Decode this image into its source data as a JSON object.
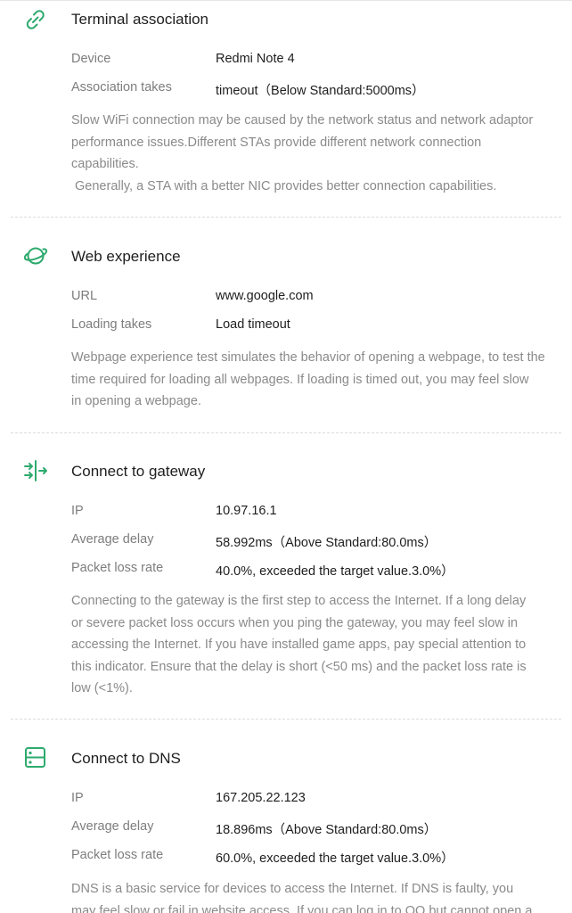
{
  "colors": {
    "accent": "#2eaa6e",
    "label": "#7d7d7d",
    "text": "#1e1e1e",
    "desc": "#8a8a8a"
  },
  "sections": [
    {
      "icon": "link-icon",
      "title": "Terminal association",
      "rows": [
        {
          "label": "Device",
          "value": "Redmi Note 4"
        },
        {
          "label": "Association takes",
          "value": "timeout（Below Standard:5000ms）"
        }
      ],
      "description": [
        "Slow WiFi connection may be caused by the network status and network adaptor",
        "performance issues.Different STAs provide different network connection",
        "capabilities.",
        " Generally, a STA with a better NIC provides better connection capabilities."
      ]
    },
    {
      "icon": "planet-icon",
      "title": "Web experience",
      "rows": [
        {
          "label": "URL",
          "value": "www.google.com"
        },
        {
          "label": "Loading takes",
          "value": "Load timeout"
        }
      ],
      "description": [
        "Webpage experience test simulates the behavior of opening a webpage, to test the",
        "time required for loading all webpages. If loading is timed out, you may feel slow",
        "in opening a webpage."
      ]
    },
    {
      "icon": "gateway-icon",
      "title": "Connect to gateway",
      "rows": [
        {
          "label": "IP",
          "value": "10.97.16.1"
        },
        {
          "label": "Average delay",
          "value": "58.992ms（Above Standard:80.0ms）"
        },
        {
          "label": "Packet loss rate",
          "value": "40.0%, exceeded the target value.3.0%）"
        }
      ],
      "description": [
        "Connecting to the gateway is the first step to access the Internet. If a long delay",
        "or severe packet loss occurs when you ping the gateway, you may feel slow in",
        "accessing the Internet. If you have installed game apps, pay special attention to",
        "this indicator. Ensure that the delay is short (<50 ms) and the packet loss rate is",
        "low (<1%)."
      ]
    },
    {
      "icon": "server-icon",
      "title": "Connect to DNS",
      "rows": [
        {
          "label": "IP",
          "value": "167.205.22.123"
        },
        {
          "label": "Average delay",
          "value": "18.896ms（Above Standard:80.0ms）"
        },
        {
          "label": "Packet loss rate",
          "value": "60.0%, exceeded the target value.3.0%）"
        }
      ],
      "description": [
        "DNS is a basic service for devices to access the Internet. If DNS is faulty, you",
        "may feel slow or fail in website access. If you can log in to QQ but cannot open a"
      ]
    }
  ]
}
